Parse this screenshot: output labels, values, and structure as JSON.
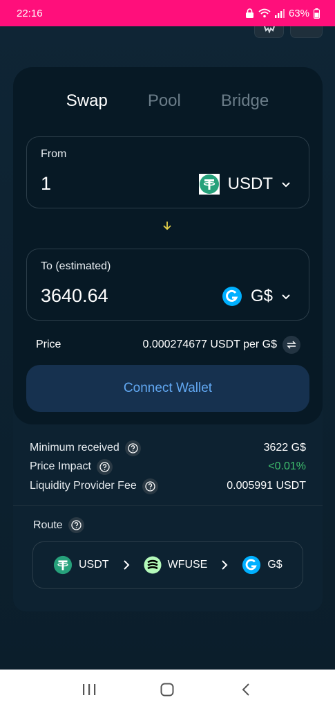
{
  "status_bar": {
    "time": "22:16",
    "battery": "63%"
  },
  "tabs": [
    {
      "label": "Swap",
      "active": true
    },
    {
      "label": "Pool",
      "active": false
    },
    {
      "label": "Bridge",
      "active": false
    }
  ],
  "from": {
    "label": "From",
    "amount": "1",
    "token": "USDT",
    "token_icon": "usdt-icon"
  },
  "to": {
    "label": "To (estimated)",
    "amount": "3640.64",
    "token": "G$",
    "token_icon": "gooddollar-icon"
  },
  "price": {
    "label": "Price",
    "value": "0.000274677 USDT per G$"
  },
  "connect_button": {
    "label": "Connect Wallet"
  },
  "details": {
    "minimum_received": {
      "label": "Minimum received",
      "value": "3622 G$"
    },
    "price_impact": {
      "label": "Price Impact",
      "value": "<0.01%"
    },
    "lp_fee": {
      "label": "Liquidity Provider Fee",
      "value": "0.005991 USDT"
    }
  },
  "route": {
    "label": "Route",
    "steps": [
      {
        "token": "USDT",
        "icon": "usdt-icon"
      },
      {
        "token": "WFUSE",
        "icon": "wfuse-icon"
      },
      {
        "token": "G$",
        "icon": "gooddollar-icon"
      }
    ]
  },
  "colors": {
    "status_bar": "#ff0f7b",
    "background": "#0c1f2c",
    "card": "#071925",
    "accent_blue": "#62a8f2",
    "green": "#3fbf6d",
    "usdt": "#26a17b",
    "gooddollar": "#00b0ff",
    "swap_arrow": "#e6d24a"
  }
}
